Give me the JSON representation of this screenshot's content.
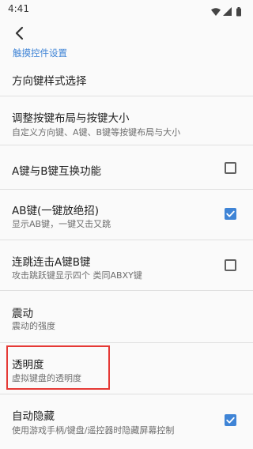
{
  "status_bar": {
    "time": "4:41",
    "icons": [
      "wifi-icon",
      "signal-icon",
      "battery-icon"
    ]
  },
  "app_bar": {
    "back_icon": "back-arrow-icon"
  },
  "section": {
    "header": "触摸控件设置"
  },
  "prefs": [
    {
      "title": "方向键样式选择"
    },
    {
      "title": "调整按键布局与按键大小",
      "summary": "自定义方向键、A键、B键等按键布局与大小"
    },
    {
      "title": "A键与B键互换功能",
      "checked": false
    },
    {
      "title": "AB键(一键放绝招)",
      "summary": "显示AB键，一键又击又跳",
      "checked": true
    },
    {
      "title": "连跳连击A键B键",
      "summary": "攻击跳跃键显示四个 类同ABXY键",
      "checked": false
    },
    {
      "title": "震动",
      "summary": "震动的强度"
    },
    {
      "title": "透明度",
      "summary": "虚拟键盘的透明度"
    },
    {
      "title": "自动隐藏",
      "summary": "使用游戏手柄/键盘/遥控器时隐藏屏幕控制",
      "checked": true
    }
  ],
  "colors": {
    "accent": "#3f84d6",
    "highlight": "#e53935"
  }
}
